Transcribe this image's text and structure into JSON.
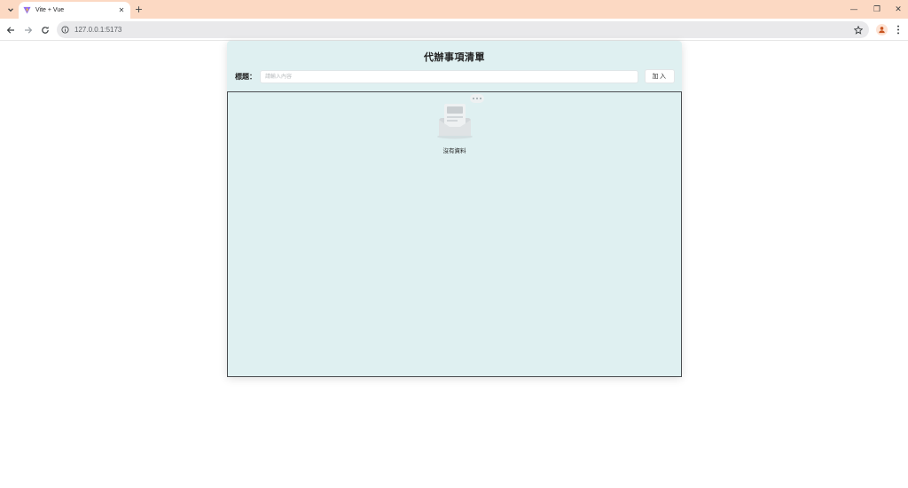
{
  "browser": {
    "tab_title": "Vite + Vue",
    "url": "127.0.0.1:5173",
    "tab_close_glyph": "✕",
    "new_tab_glyph": "+",
    "window_controls": {
      "minimize": "—",
      "restore": "❐",
      "close": "✕"
    },
    "icons": [
      "tab-search-icon",
      "vite-favicon-icon",
      "back-icon",
      "forward-icon",
      "reload-icon",
      "site-info-icon",
      "bookmark-star-icon",
      "profile-icon",
      "kebab-menu-icon"
    ]
  },
  "app": {
    "title": "代辦事項清單",
    "form": {
      "label": "標題：",
      "placeholder": "請輸入內容",
      "value": "",
      "add_label": "加入"
    },
    "list": {
      "items": [],
      "empty_text": "沒有資料",
      "empty_icon": "empty-inbox-icon"
    }
  },
  "colors": {
    "tabstrip_bg": "#fcd9c3",
    "app_bg": "#dff0f1",
    "list_border": "#4a4d50"
  }
}
